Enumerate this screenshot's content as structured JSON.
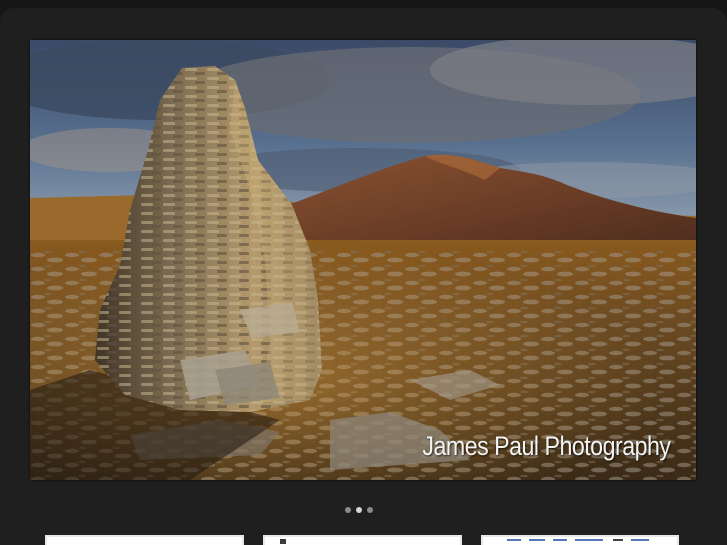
{
  "slideshow": {
    "caption": "James Paul Photography",
    "slide_count": 3,
    "active_slide": 2,
    "image_icon": "landscape-photo-cairn"
  },
  "thumbnails": [
    {
      "icon": "site-screenshot-thumbnail"
    },
    {
      "icon": "site-screenshot-thumbnail"
    },
    {
      "icon": "site-screenshot-thumbnail"
    }
  ],
  "colors": {
    "page_background": "#161616",
    "panel_background": "#1f1f1f",
    "caption_text": "#f3f3f3",
    "dot_inactive": "#8a8a8a",
    "dot_active": "#d6d6d6"
  }
}
